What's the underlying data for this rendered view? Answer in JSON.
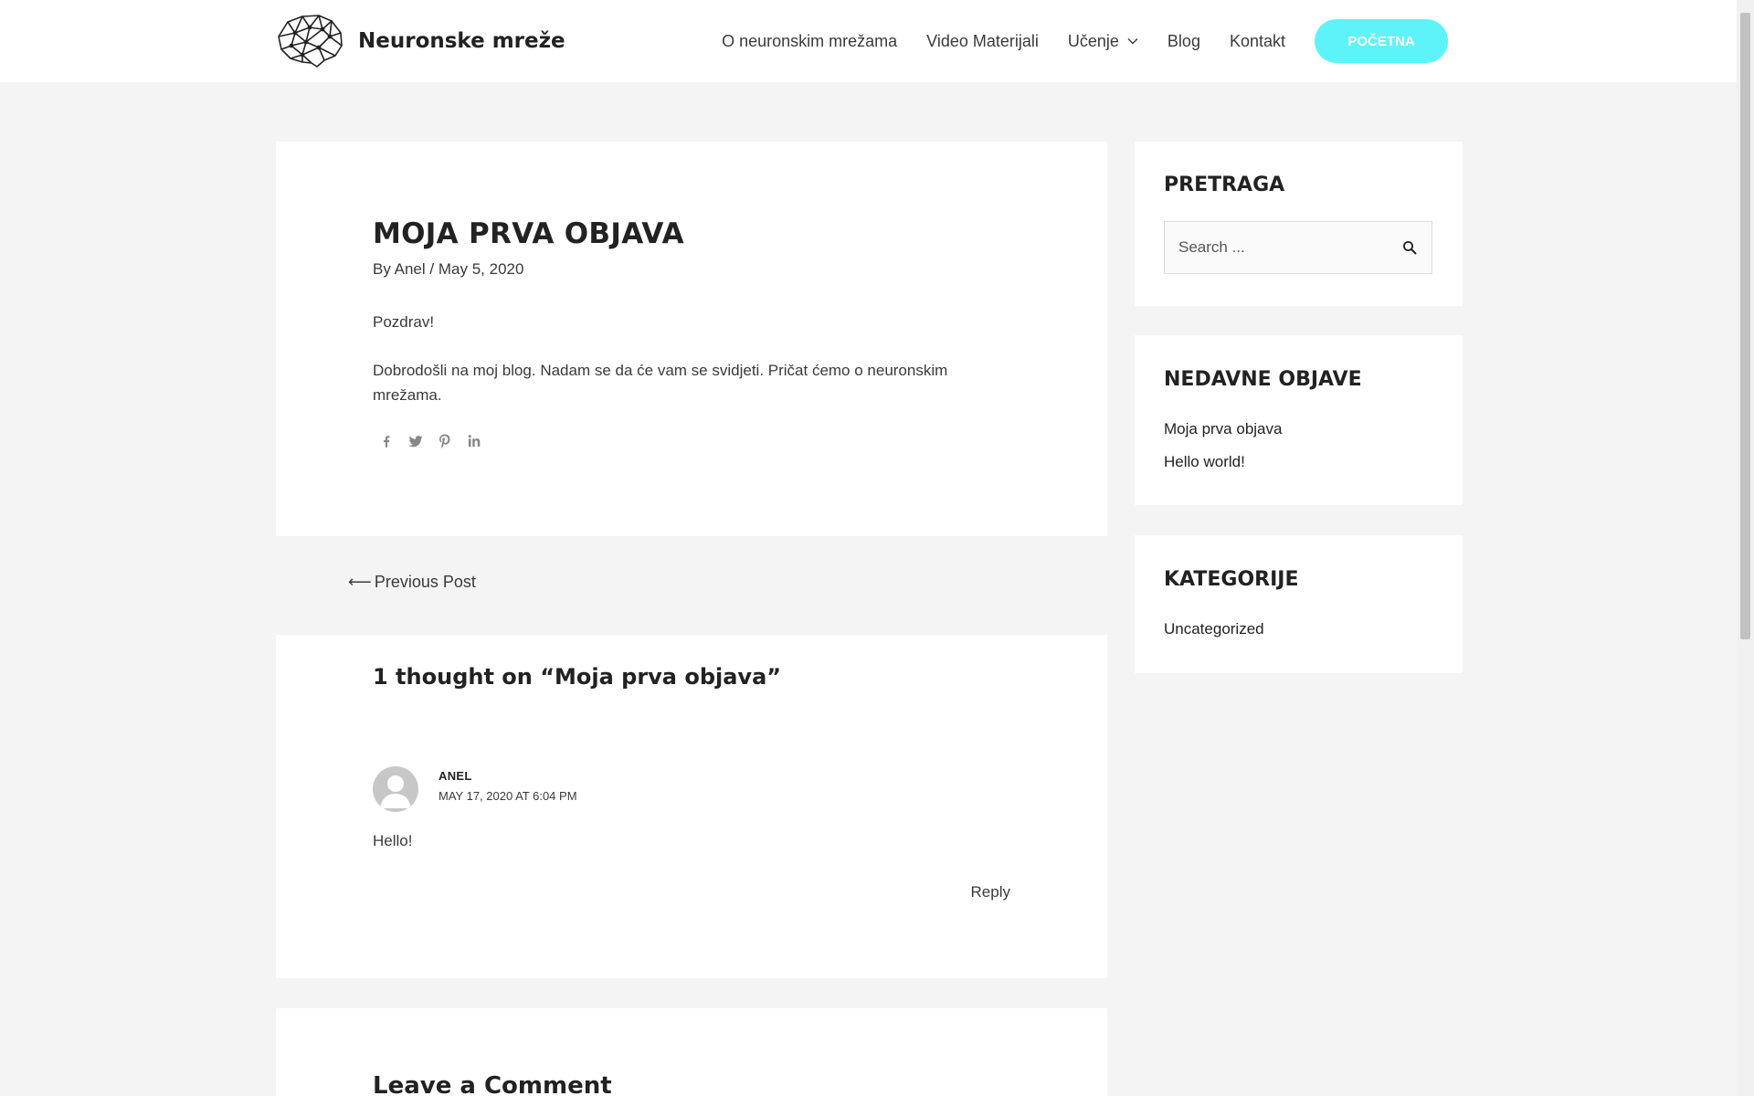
{
  "site": {
    "title": "Neuronske mreže"
  },
  "nav": {
    "items": [
      {
        "label": "O neuronskim mrežama"
      },
      {
        "label": "Video Materijali"
      },
      {
        "label": "Učenje"
      },
      {
        "label": "Blog"
      },
      {
        "label": "Kontakt"
      }
    ],
    "cta_label": "POČETNA"
  },
  "post": {
    "title": "MOJA PRVA OBJAVA",
    "by": "By",
    "author": "Anel",
    "separator": "/",
    "date": "May 5, 2020",
    "paragraphs": [
      "Pozdrav!",
      "Dobrodošli na moj blog. Nadam se da će vam se svidjeti. Pričat ćemo o neuronskim mrežama."
    ],
    "share_icons": [
      "facebook-icon",
      "twitter-icon",
      "pinterest-icon",
      "linkedin-icon"
    ]
  },
  "navigation": {
    "prev_arrow": "⟵",
    "prev_label": "Previous Post"
  },
  "comments": {
    "title": "1 thought on “Moja prva objava”",
    "items": [
      {
        "author": "ANEL",
        "date": "MAY 17, 2020 AT 6:04 PM",
        "text": "Hello!",
        "reply_label": "Reply"
      }
    ]
  },
  "leave_comment": {
    "title": "Leave a Comment"
  },
  "sidebar": {
    "search": {
      "title": "PRETRAGA",
      "placeholder": "Search ..."
    },
    "recent": {
      "title": "NEDAVNE OBJAVE",
      "items": [
        "Moja prva objava",
        "Hello world!"
      ]
    },
    "categories": {
      "title": "KATEGORIJE",
      "items": [
        "Uncategorized"
      ]
    }
  },
  "colors": {
    "accent": "#5ef3f9",
    "background": "#f4f4f4",
    "card": "#ffffff",
    "text": "#3a3a3a",
    "heading": "#222222"
  }
}
